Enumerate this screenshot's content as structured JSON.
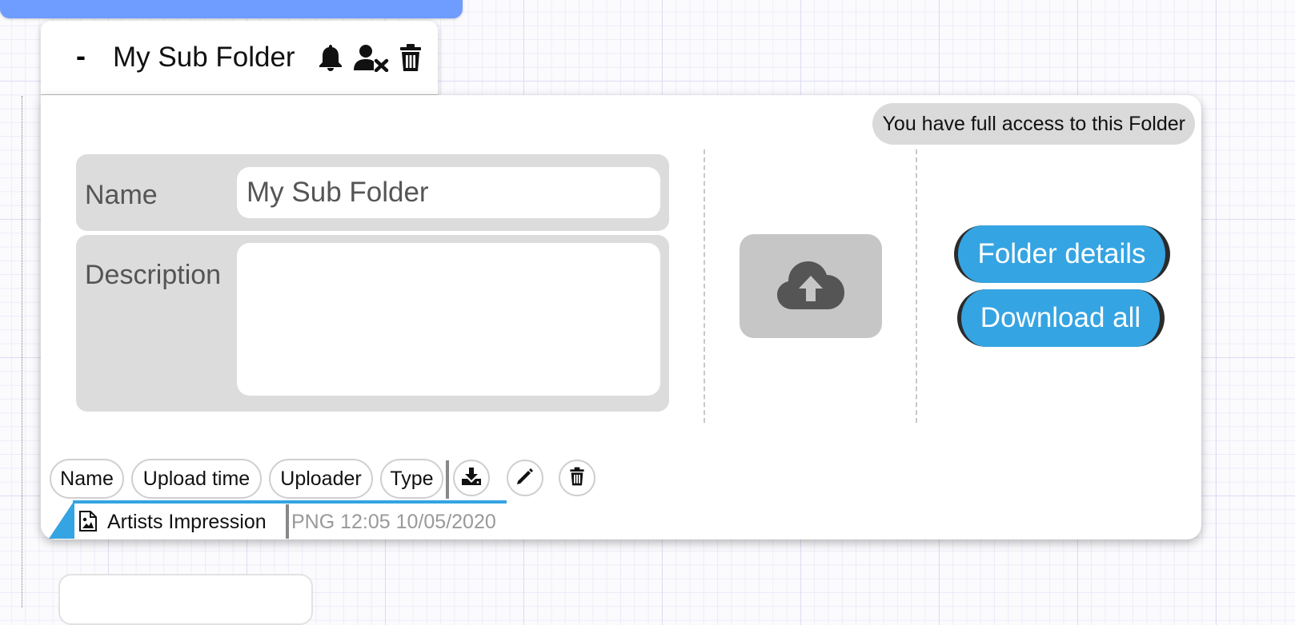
{
  "folder_tab": {
    "collapse_label": "-",
    "title": "My Sub Folder",
    "icons": [
      "bell-icon",
      "user-remove-icon",
      "trash-icon"
    ]
  },
  "panel": {
    "access_badge": "You have full access to this Folder",
    "form": {
      "name_label": "Name",
      "name_value": "My Sub Folder",
      "description_label": "Description",
      "description_value": ""
    },
    "upload_icon": "cloud-upload-icon",
    "buttons": {
      "folder_details": "Folder details",
      "download_all": "Download all"
    },
    "file_table": {
      "columns": [
        "Name",
        "Upload time",
        "Uploader",
        "Type"
      ],
      "actions": [
        "download-icon",
        "pencil-icon",
        "trash-icon"
      ],
      "rows": [
        {
          "name": "Artists Impression",
          "meta": "PNG 12:05 10/05/2020",
          "icon": "image-file-icon"
        }
      ]
    }
  },
  "colors": {
    "accent": "#35a4e2",
    "top_bar": "#6f9cff",
    "field_bg": "#dcdcdc",
    "upload_bg": "#c6c6c6"
  }
}
